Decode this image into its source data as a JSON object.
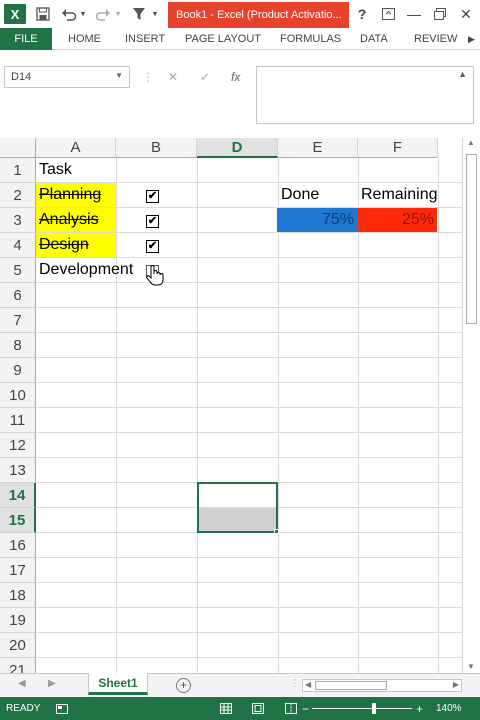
{
  "window": {
    "title": "Book1 - Excel (Product Activatio...",
    "excel_icon": "X",
    "help": "?",
    "minimize": "—",
    "close": "✕"
  },
  "quick_access": {
    "save_icon": "save-icon",
    "undo_icon": "undo-icon",
    "redo_icon": "redo-icon",
    "filter_icon": "filter-icon"
  },
  "ribbon": {
    "file": "FILE",
    "tabs": [
      "HOME",
      "INSERT",
      "PAGE LAYOUT",
      "FORMULAS",
      "DATA",
      "REVIEW"
    ]
  },
  "formula_bar": {
    "name_box": "D14",
    "cancel": "✕",
    "enter": "✓",
    "fx": "fx",
    "value": ""
  },
  "columns": [
    "A",
    "B",
    "D",
    "E",
    "F"
  ],
  "selected_column": "D",
  "rows": [
    "1",
    "2",
    "3",
    "4",
    "5",
    "6",
    "7",
    "8",
    "9",
    "10",
    "11",
    "12",
    "13",
    "14",
    "15",
    "16",
    "17",
    "18",
    "19",
    "20",
    "21"
  ],
  "selected_rows": [
    "14",
    "15"
  ],
  "cells": {
    "a1": "Task",
    "a2": "Planning",
    "a3": "Analysis",
    "a4": "Design",
    "a5": "Development",
    "e2": "Done",
    "f2": "Remaining",
    "e3": "75%",
    "f3": "25%"
  },
  "checkboxes": [
    {
      "row": "2",
      "checked": true
    },
    {
      "row": "3",
      "checked": true
    },
    {
      "row": "4",
      "checked": true
    },
    {
      "row": "5",
      "checked": false
    }
  ],
  "check_mark": "✔",
  "progress": {
    "done_fraction": 0.75,
    "remaining_fraction": 0.25
  },
  "colors": {
    "excel_green": "#217346",
    "done": "#1f77d0",
    "remaining": "#ff2a0a",
    "highlight": "#ffff00",
    "title_red": "#e8412c"
  },
  "sheet_tabs": [
    "Sheet1"
  ],
  "add_sheet": "+",
  "status": {
    "ready": "READY",
    "zoom": "140%"
  }
}
